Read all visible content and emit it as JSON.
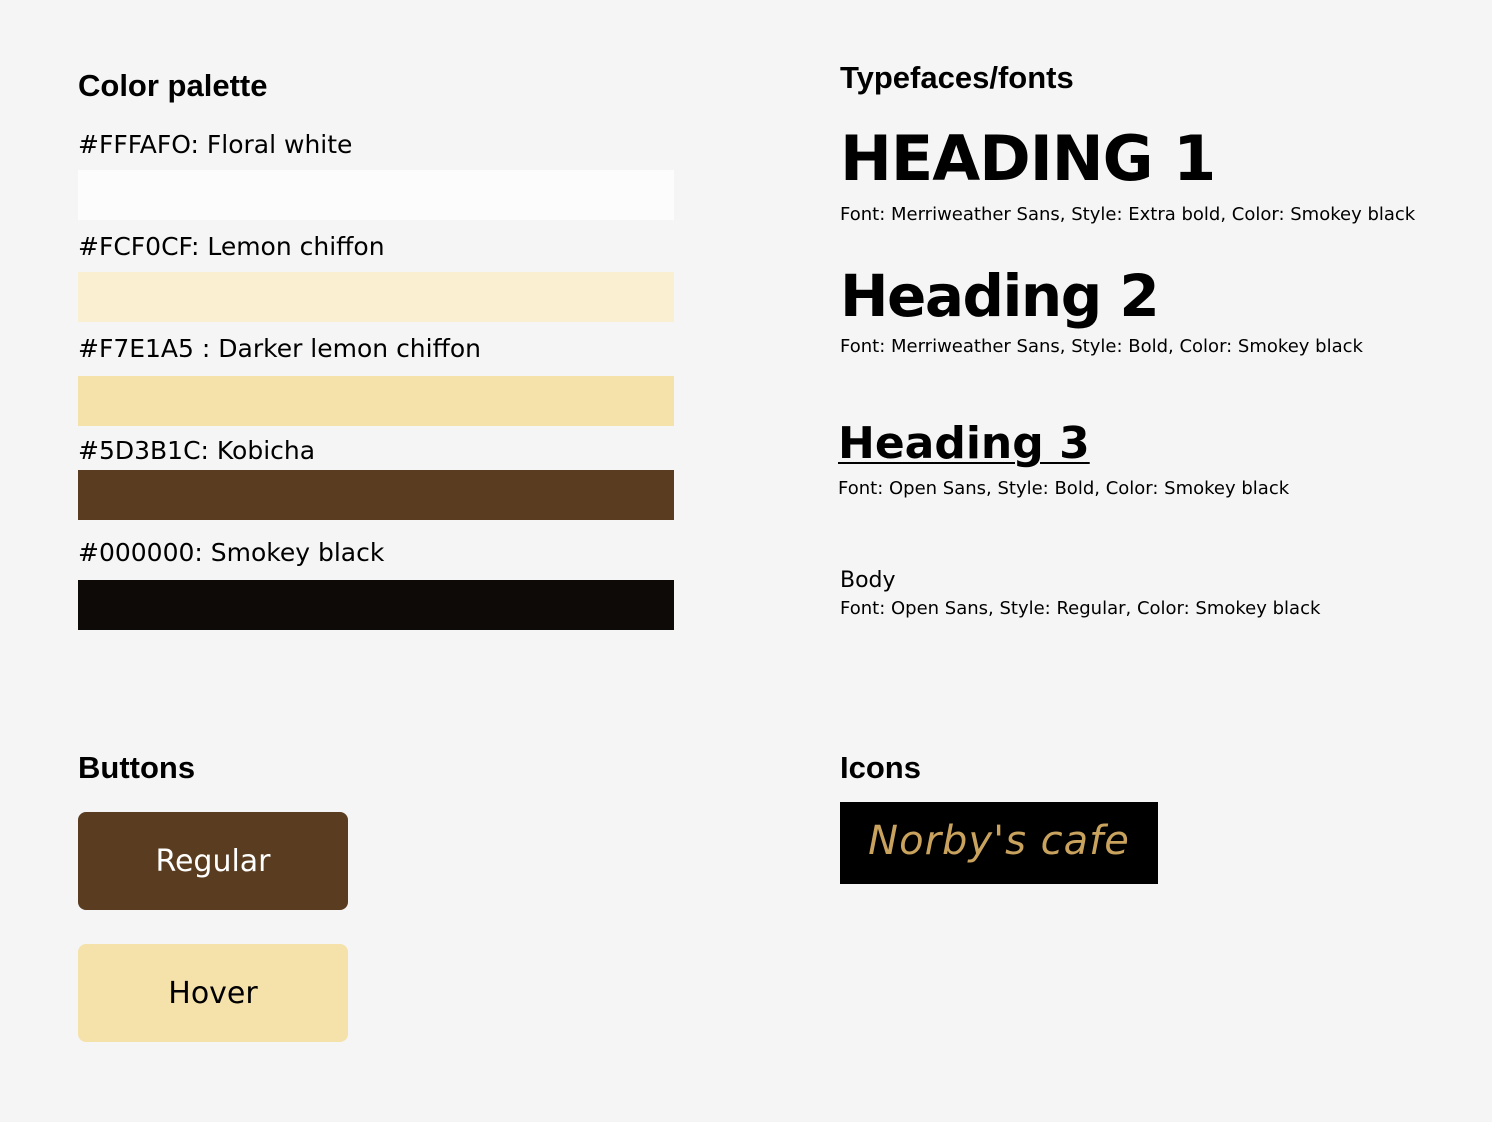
{
  "palette": {
    "title": "Color palette",
    "swatches": [
      {
        "label": "#FFFAFO: Floral white",
        "color": "#fcfcfc"
      },
      {
        "label": "#FCF0CF: Lemon chiffon",
        "color": "#faf0d1"
      },
      {
        "label": "#F7E1A5 : Darker lemon chiffon",
        "color": "#f5e1aa"
      },
      {
        "label": "#5D3B1C: Kobicha",
        "color": "#5a3c20"
      },
      {
        "label": "#000000: Smokey black",
        "color": "#0d0a07"
      }
    ]
  },
  "typefaces": {
    "title": "Typefaces/fonts",
    "heading1": {
      "sample": "HEADING 1",
      "caption": "Font: Merriweather Sans, Style: Extra bold, Color: Smokey black"
    },
    "heading2": {
      "sample": "Heading 2",
      "caption": "Font: Merriweather Sans, Style: Bold, Color: Smokey black"
    },
    "heading3": {
      "sample": "Heading 3",
      "caption": "Font: Open Sans, Style: Bold, Color: Smokey black"
    },
    "body": {
      "sample": "Body",
      "caption": "Font: Open Sans, Style: Regular, Color: Smokey black"
    }
  },
  "buttons": {
    "title": "Buttons",
    "regular": {
      "label": "Regular",
      "bg": "#5a3c20",
      "text_color": "#ffffff"
    },
    "hover": {
      "label": "Hover",
      "bg": "#f5e1aa",
      "text_color": "#000000"
    }
  },
  "icons": {
    "title": "Icons",
    "logo": {
      "text": "Norby's cafe",
      "bg": "#000000",
      "text_color": "#c9a35e"
    }
  }
}
